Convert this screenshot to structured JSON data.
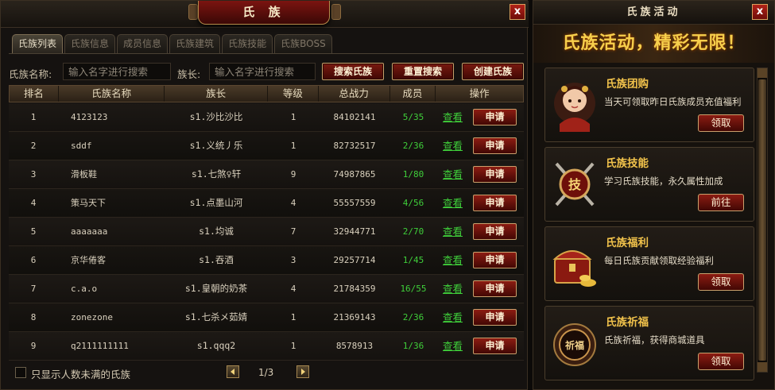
{
  "clan_panel": {
    "title": "氏 族",
    "close": "x",
    "tabs": [
      {
        "label": "氏族列表"
      },
      {
        "label": "氏族信息"
      },
      {
        "label": "成员信息"
      },
      {
        "label": "氏族建筑"
      },
      {
        "label": "氏族技能"
      },
      {
        "label": "氏族BOSS"
      }
    ],
    "search": {
      "clan_name_label": "氏族名称:",
      "clan_name_placeholder": "输入名字进行搜索",
      "leader_label": "族长:",
      "leader_placeholder": "输入名字进行搜索",
      "search_button": "搜索氏族",
      "reset_button": "重置搜索",
      "create_button": "创建氏族"
    },
    "table": {
      "headers": [
        "排名",
        "氏族名称",
        "族长",
        "等级",
        "总战力",
        "成员",
        "操作"
      ],
      "rows": [
        {
          "rank": "1",
          "name": "4123123",
          "leader": "s1.沙比沙比",
          "level": "1",
          "power": "84102141",
          "members": "5/35",
          "view": "查看",
          "apply": "申请"
        },
        {
          "rank": "2",
          "name": "sddf",
          "leader": "s1.义统丿乐",
          "level": "1",
          "power": "82732517",
          "members": "2/36",
          "view": "查看",
          "apply": "申请"
        },
        {
          "rank": "3",
          "name": "滑板鞋",
          "leader": "s1.七煞♀轩",
          "level": "9",
          "power": "74987865",
          "members": "1/80",
          "view": "查看",
          "apply": "申请"
        },
        {
          "rank": "4",
          "name": "策马天下",
          "leader": "s1.点墨山河",
          "level": "4",
          "power": "55557559",
          "members": "4/56",
          "view": "查看",
          "apply": "申请"
        },
        {
          "rank": "5",
          "name": "aaaaaaa",
          "leader": "s1.均诚",
          "level": "7",
          "power": "32944771",
          "members": "2/70",
          "view": "查看",
          "apply": "申请"
        },
        {
          "rank": "6",
          "name": "京华倦客",
          "leader": "s1.吞酒",
          "level": "3",
          "power": "29257714",
          "members": "1/45",
          "view": "查看",
          "apply": "申请"
        },
        {
          "rank": "7",
          "name": "c.a.o",
          "leader": "s1.皇朝的奶茶",
          "level": "4",
          "power": "21784359",
          "members": "16/55",
          "view": "查看",
          "apply": "申请"
        },
        {
          "rank": "8",
          "name": "zonezone",
          "leader": "s1.七杀メ茹婧",
          "level": "1",
          "power": "21369143",
          "members": "2/36",
          "view": "查看",
          "apply": "申请"
        },
        {
          "rank": "9",
          "name": "q2111111111",
          "leader": "s1.qqq2",
          "level": "1",
          "power": "8578913",
          "members": "1/36",
          "view": "查看",
          "apply": "申请"
        }
      ]
    },
    "footer": {
      "filter_label": "只显示人数未满的氏族",
      "page": "1/3"
    }
  },
  "activity_panel": {
    "title": "氏族活动",
    "close": "x",
    "banner": "氏族活动，精彩无限！",
    "cards": [
      {
        "title": "氏族团购",
        "desc": "当天可领取昨日氏族成员充值福利",
        "button": "领取",
        "icon": "girl-portrait-icon"
      },
      {
        "title": "氏族技能",
        "desc": "学习氏族技能，永久属性加成",
        "button": "前往",
        "icon": "skill-shield-icon",
        "icon_text": "技"
      },
      {
        "title": "氏族福利",
        "desc": "每日氏族贡献领取经验福利",
        "button": "领取",
        "icon": "treasure-chest-icon"
      },
      {
        "title": "氏族祈福",
        "desc": "氏族祈福，获得商城道具",
        "button": "领取",
        "icon": "prayer-emblem-icon",
        "icon_text": "祈福"
      }
    ]
  },
  "colors": {
    "accent_red": "#8c1c12",
    "gold_text": "#f1c24b",
    "member_green": "#3fce3a"
  }
}
